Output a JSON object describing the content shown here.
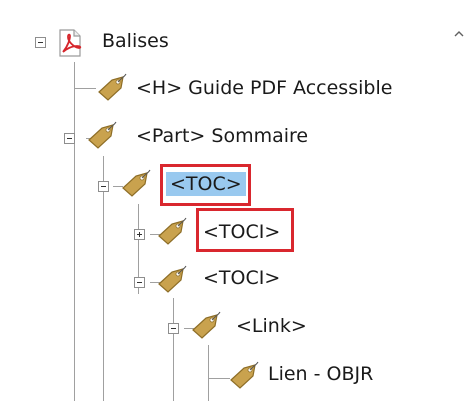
{
  "tree": {
    "root": {
      "label": "Balises",
      "icon": "pdf-tags-icon",
      "state": "expanded"
    },
    "nodes": [
      {
        "label": "<H> Guide PDF Accessible",
        "icon": "tag-icon",
        "state": "leaf"
      },
      {
        "label": "<Part> Sommaire",
        "icon": "tag-icon",
        "state": "expanded"
      },
      {
        "label": "<TOC>",
        "icon": "tag-icon",
        "state": "expanded",
        "selected": true,
        "highlighted": true
      },
      {
        "label": "<TOCI>",
        "icon": "tag-icon",
        "state": "collapsed",
        "highlighted": true
      },
      {
        "label": "<TOCI>",
        "icon": "tag-icon",
        "state": "expanded"
      },
      {
        "label": "<Link>",
        "icon": "tag-icon",
        "state": "expanded"
      },
      {
        "label": "Lien - OBJR",
        "icon": "tag-icon",
        "state": "leaf"
      }
    ]
  },
  "colors": {
    "selection": "#99c9ef",
    "highlight_border": "#d9272e",
    "tag_fill": "#c9a24e",
    "pdf_red": "#d6262c"
  },
  "scrollbar": {
    "icon": "scroll-up-icon"
  }
}
